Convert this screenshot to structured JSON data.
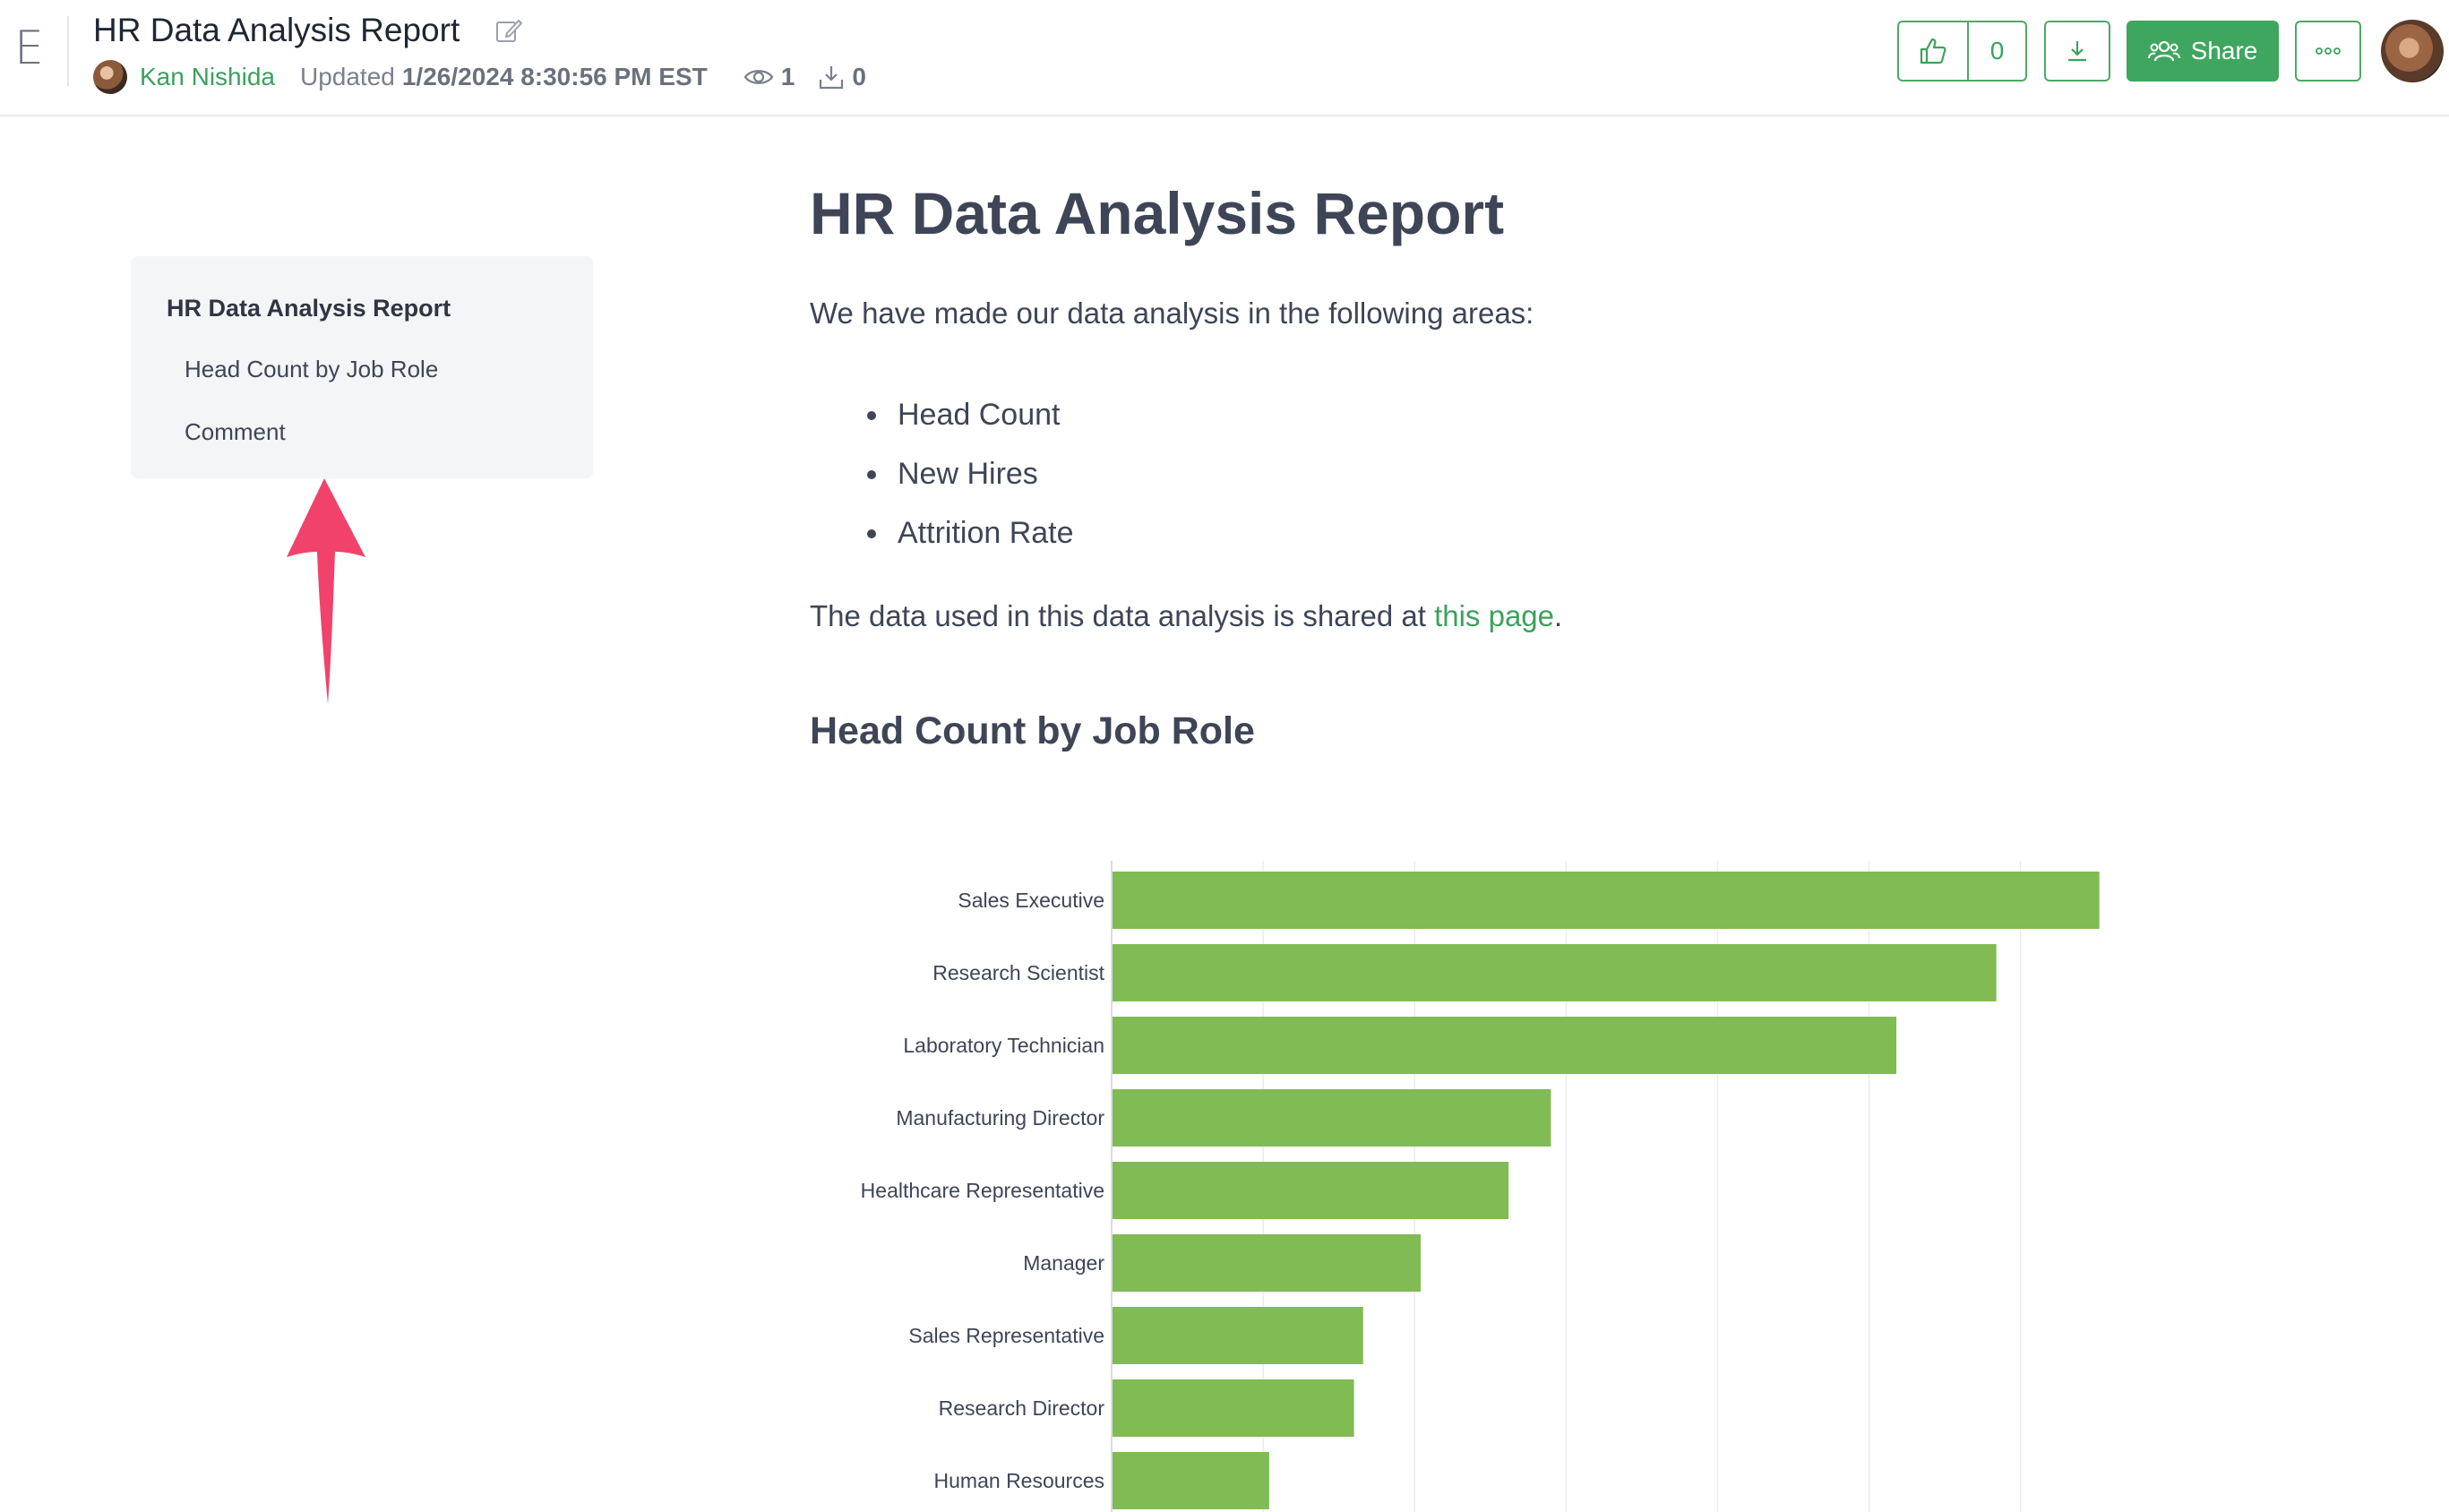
{
  "header": {
    "app_letter": "E",
    "doc_title": "HR Data Analysis Report",
    "author": "Kan Nishida",
    "updated_label": "Updated",
    "updated_date": "1/26/2024 8:30:56 PM EST",
    "views": "1",
    "downloads": "0",
    "like_count": "0",
    "share_label": "Share",
    "accent_color": "#3fa65f"
  },
  "toc": {
    "title": "HR Data Analysis Report",
    "items": [
      {
        "label": "Head Count by Job Role"
      },
      {
        "label": "Comment"
      }
    ],
    "annotation_color": "#f0426a"
  },
  "main": {
    "title": "HR Data Analysis Report",
    "intro": "We have made our data analysis in the following areas:",
    "bullets": [
      "Head Count",
      "New Hires",
      "Attrition Rate"
    ],
    "data_note_prefix": "The data used in this data analysis is shared at ",
    "data_note_link": "this page",
    "data_note_suffix": ".",
    "section_title": "Head Count by Job Role"
  },
  "chart_data": {
    "type": "bar",
    "orientation": "horizontal",
    "title": "",
    "xlabel": "",
    "ylabel": "",
    "bar_color": "#80bb53",
    "grid": true,
    "xlim": [
      0,
      340
    ],
    "categories": [
      "Sales Executive",
      "Research Scientist",
      "Laboratory Technician",
      "Manufacturing Director",
      "Healthcare Representative",
      "Manager",
      "Sales Representative",
      "Research Director",
      "Human Resources"
    ],
    "values": [
      326,
      292,
      259,
      145,
      131,
      102,
      83,
      80,
      52
    ]
  }
}
